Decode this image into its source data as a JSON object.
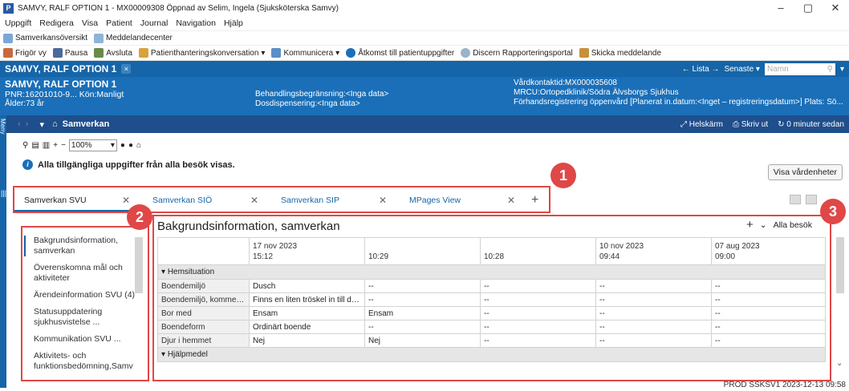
{
  "window": {
    "app_icon": "P",
    "title": "SAMVY, RALF OPTION 1 - MX00009308 Öppnad av Selim, Ingela (Sjuksköterska Samvy)",
    "controls": [
      "–",
      "▢",
      "✕"
    ]
  },
  "menu": [
    "Uppgift",
    "Redigera",
    "Visa",
    "Patient",
    "Journal",
    "Navigation",
    "Hjälp"
  ],
  "toolbar1": [
    "Samverkansöversikt",
    "Meddelandecenter"
  ],
  "toolbar2": [
    "Frigör vy",
    "Pausa",
    "Avsluta",
    "Patienthanteringskonversation",
    "Kommunicera",
    "Åtkomst till patientuppgifter",
    "Discern Rapporteringsportal",
    "Skicka meddelande"
  ],
  "patient_tab": {
    "name": "SAMVY, RALF OPTION 1",
    "close": "×"
  },
  "top_right": {
    "lista": "Lista",
    "senaste": "Senaste",
    "name_placeholder": "Namn"
  },
  "banner": {
    "name": "SAMVY, RALF OPTION 1",
    "pnr": "PNR:16201010-9... Kön:Manligt",
    "age": "Ålder:73 år",
    "beh": "Behandlingsbegränsning:<Inga data>",
    "dos": "Dosdispensering:<Inga data>",
    "vk": "Vårdkontaktid:MX000035608",
    "mrcu": "MRCU:Ortopedklinik/Södra Älvsborgs Sjukhus",
    "forh": "Förhandsregistrering öppenvård [Planerat in.datum:<Inget – registreringsdatum>] Plats: Sö..."
  },
  "side_menu": {
    "label": "Meny"
  },
  "nav": {
    "home": "Samverkan",
    "helskarm": "Helskärm",
    "skrivut": "Skriv ut",
    "updated": "0 minuter sedan"
  },
  "zoom": "100%",
  "info_text": "Alla tillgängliga uppgifter från alla besök visas.",
  "visa_button": "Visa vårdenheter",
  "tabs": [
    "Samverkan SVU",
    "Samverkan SIÖ",
    "Samverkan SIP",
    "MPages View"
  ],
  "left_nav": [
    "Bakgrundsinformation, samverkan",
    "Överenskomna mål och aktiviteter",
    "Ärendeinformation SVU (4)",
    "Statusuppdatering sjukhusvistelse ...",
    "Kommunikation SVU ...",
    "Aktivitets- och funktionsbedömning,Samv"
  ],
  "section": {
    "title": "Bakgrundsinformation, samverkan",
    "filter": "Alla besök"
  },
  "grid": {
    "columns": [
      {
        "date": "17 nov 2023",
        "time": "15:12"
      },
      {
        "date": "",
        "time": "10:29"
      },
      {
        "date": "",
        "time": "10:28"
      },
      {
        "date": "10 nov 2023",
        "time": "09:44"
      },
      {
        "date": "07 aug 2023",
        "time": "09:00"
      }
    ],
    "groups": [
      {
        "name": "Hemsituation",
        "rows": [
          {
            "label": "Boendemiljö",
            "values": [
              "Dusch",
              "--",
              "--",
              "--",
              "--"
            ]
          },
          {
            "label": "Boendemiljö, kommentar",
            "values": [
              "Finns en liten tröskel in till dus...",
              "--",
              "--",
              "--",
              "--"
            ]
          },
          {
            "label": "Bor med",
            "values": [
              "Ensam",
              "Ensam",
              "--",
              "--",
              "--"
            ]
          },
          {
            "label": "Boendeform",
            "values": [
              "Ordinärt boende",
              "--",
              "--",
              "--",
              "--"
            ]
          },
          {
            "label": "Djur i hemmet",
            "values": [
              "Nej",
              "Nej",
              "--",
              "--",
              "--"
            ]
          }
        ]
      },
      {
        "name": "Hjälpmedel",
        "rows": []
      }
    ]
  },
  "badges": [
    "1",
    "2",
    "3"
  ],
  "status": "PROD  SSKSV1  2023-12-13  09:58"
}
